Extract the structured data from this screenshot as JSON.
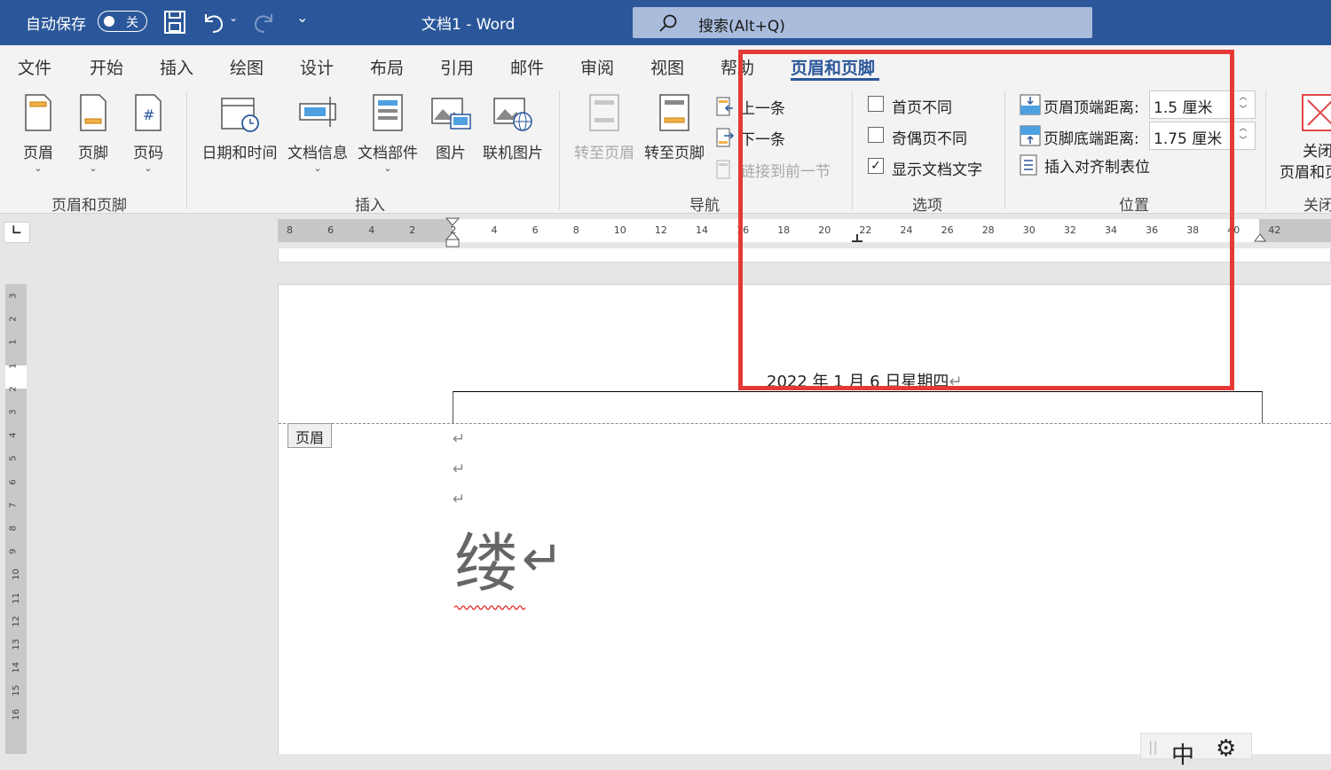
{
  "titlebar": {
    "autosave_label": "自动保存",
    "autosave_state": "关",
    "doc_title": "文档1  -  Word",
    "search_placeholder": "搜索(Alt+Q)"
  },
  "tabs": [
    "文件",
    "开始",
    "插入",
    "绘图",
    "设计",
    "布局",
    "引用",
    "邮件",
    "审阅",
    "视图",
    "帮助",
    "页眉和页脚"
  ],
  "active_tab": "页眉和页脚",
  "ribbon": {
    "hf": {
      "header": "页眉",
      "footer": "页脚",
      "pagenum": "页码",
      "group": "页眉和页脚"
    },
    "insert": {
      "datetime": "日期和时间",
      "docinfo": "文档信息",
      "quickparts": "文档部件",
      "picture": "图片",
      "online": "联机图片",
      "group": "插入"
    },
    "nav": {
      "goto_header": "转至页眉",
      "goto_footer": "转至页脚",
      "prev": "上一条",
      "next": "下一条",
      "link": "链接到前一节",
      "group": "导航"
    },
    "options": {
      "diff_first": "首页不同",
      "diff_odd_even": "奇偶页不同",
      "show_doc_text": "显示文档文字",
      "group": "选项"
    },
    "position": {
      "header_top": "页眉顶端距离:",
      "header_top_val": "1.5 厘米",
      "footer_bottom": "页脚底端距离:",
      "footer_bottom_val": "1.75 厘米",
      "insert_align_tab": "插入对齐制表位",
      "group": "位置"
    },
    "close": {
      "label1": "关闭",
      "label2": "页眉和页",
      "group": "关闭"
    }
  },
  "ruler_h": [
    "8",
    "6",
    "4",
    "2",
    "2",
    "4",
    "6",
    "8",
    "10",
    "12",
    "14",
    "16",
    "18",
    "20",
    "22",
    "24",
    "26",
    "28",
    "30",
    "32",
    "34",
    "36",
    "38",
    "40",
    "42"
  ],
  "ruler_v": [
    "3",
    "2",
    "1",
    "1",
    "2",
    "3",
    "4",
    "5",
    "6",
    "7",
    "8",
    "9",
    "10",
    "11",
    "12",
    "13",
    "14",
    "15",
    "16"
  ],
  "document": {
    "header_text": "2022 年 1 月 6 日星期四",
    "header_tag": "页眉",
    "big_char": "缕",
    "para_mark": "↵"
  },
  "ime": {
    "mode": "中"
  },
  "colors": {
    "titlebar": "#2b579a",
    "accent": "#2b579a",
    "highlight": "#e53935"
  }
}
